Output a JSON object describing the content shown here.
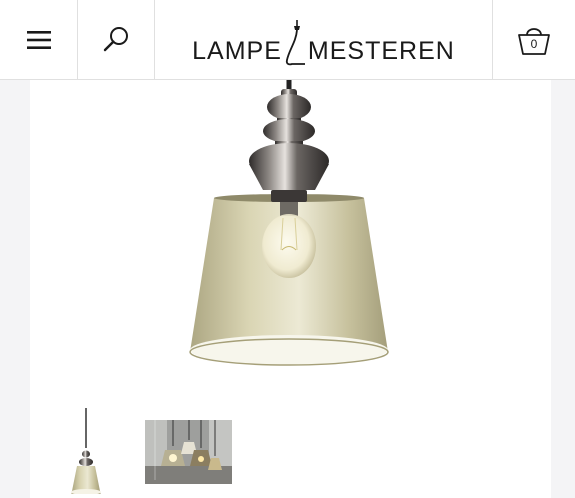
{
  "header": {
    "logo": {
      "left_text": "LAMPE",
      "right_text": "MESTEREN"
    },
    "cart": {
      "count": "0"
    }
  },
  "icons": {
    "menu": "hamburger-menu-icon",
    "search": "search-icon",
    "cart": "basket-icon"
  },
  "gallery": {
    "main_image": "pendant-lamp-photo",
    "thumbnails": [
      "pendant-lamp-thumbnail",
      "lamp-group-thumbnail"
    ]
  },
  "colors": {
    "text": "#1a1a1a",
    "border": "#e0e0e0",
    "page_side": "#f4f4f6",
    "glass": "#c9c39a",
    "chrome": "#4a4644"
  }
}
